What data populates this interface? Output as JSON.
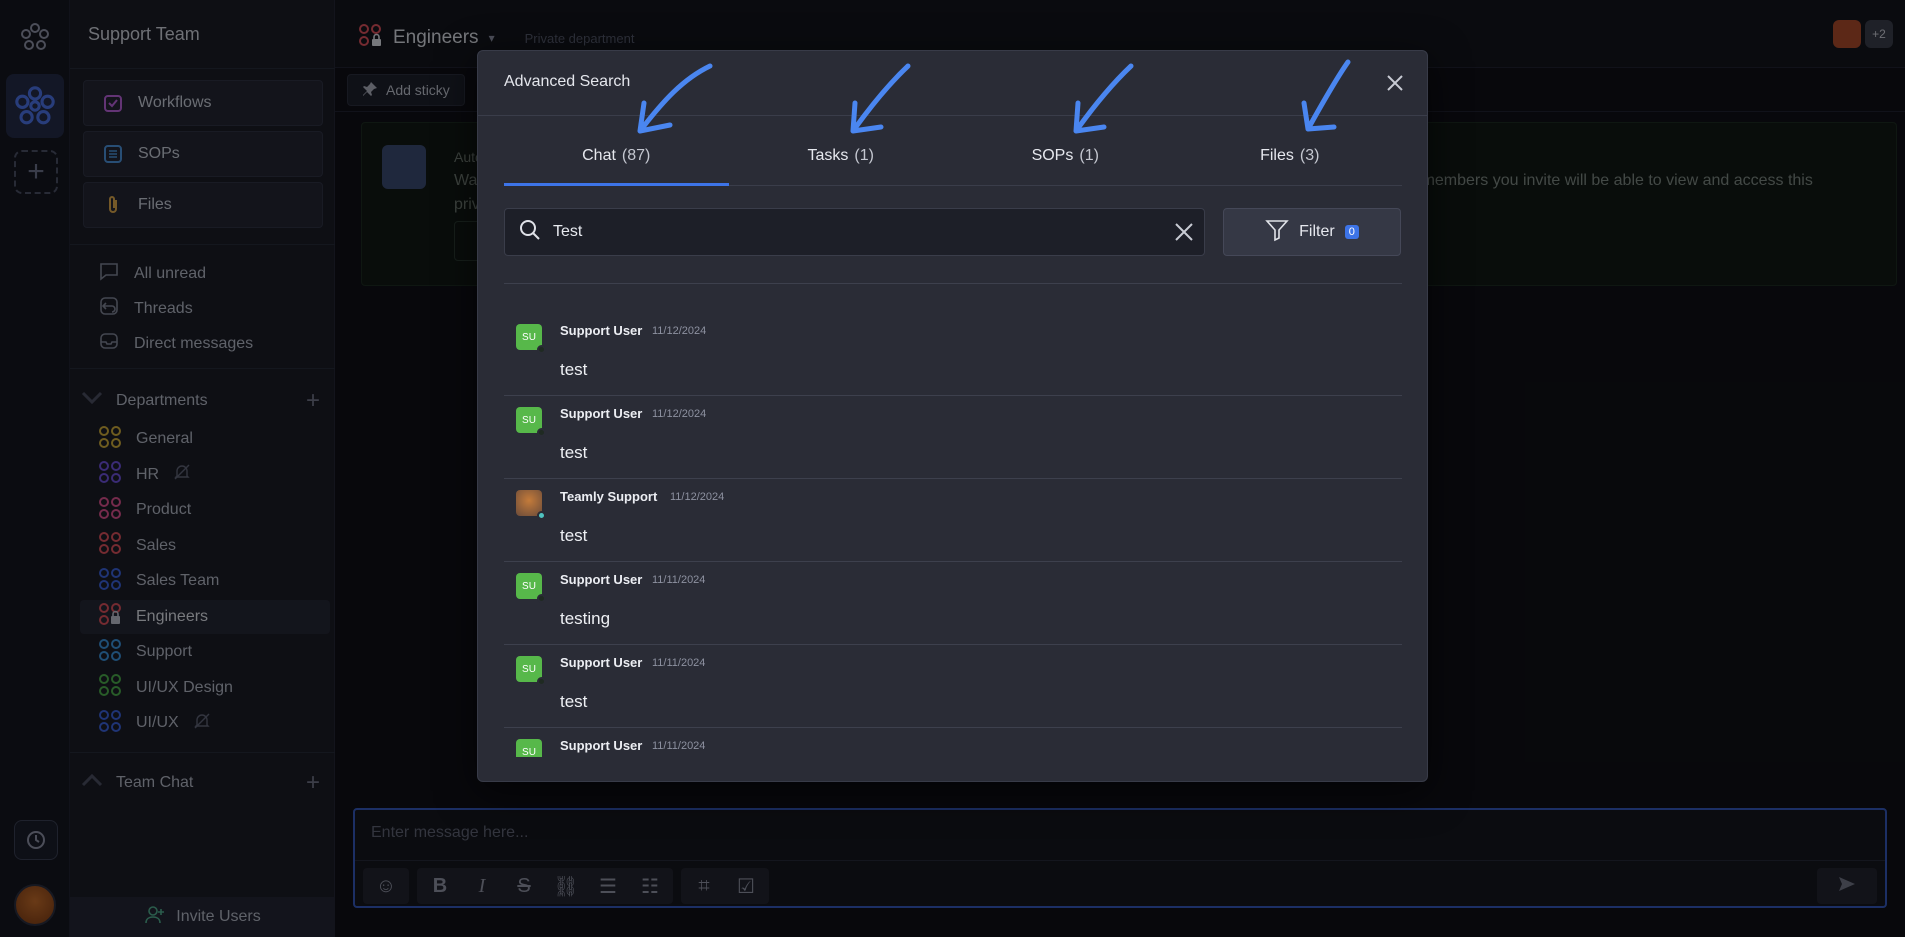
{
  "workspace": {
    "name": "Support Team"
  },
  "sidebar": {
    "nav": [
      {
        "label": "Workflows",
        "icon": "workflow-icon",
        "color": "#b45fd6"
      },
      {
        "label": "SOPs",
        "icon": "sop-icon",
        "color": "#4a8fd6"
      },
      {
        "label": "Files",
        "icon": "paperclip-icon",
        "color": "#d6a24a"
      }
    ],
    "links": [
      {
        "label": "All unread",
        "icon": "chat-bubble-icon"
      },
      {
        "label": "Threads",
        "icon": "threads-icon"
      },
      {
        "label": "Direct messages",
        "icon": "inbox-icon"
      }
    ],
    "departments_label": "Departments",
    "departments": [
      {
        "label": "General",
        "color": "#c9a83a",
        "muted": false,
        "locked": false
      },
      {
        "label": "HR",
        "color": "#6a4fd6",
        "muted": true,
        "locked": false
      },
      {
        "label": "Product",
        "color": "#d64f8a",
        "muted": false,
        "locked": false
      },
      {
        "label": "Sales",
        "color": "#d64f5a",
        "muted": false,
        "locked": false
      },
      {
        "label": "Sales Team",
        "color": "#3a5fd6",
        "muted": false,
        "locked": false
      },
      {
        "label": "Engineers",
        "color": "#d64f5a",
        "muted": false,
        "locked": true
      },
      {
        "label": "Support",
        "color": "#3a8fd6",
        "muted": false,
        "locked": false
      },
      {
        "label": "UI/UX Design",
        "color": "#4aa84a",
        "muted": false,
        "locked": false
      },
      {
        "label": "UI/UX",
        "color": "#3a5fd6",
        "muted": true,
        "locked": false
      }
    ],
    "team_chat_label": "Team Chat",
    "invite_label": "Invite Users"
  },
  "header": {
    "channel": "Engineers",
    "subtitle": "Private department",
    "extra_members": "+2"
  },
  "toolbar": {
    "add_sticky": "Add sticky"
  },
  "banner": {
    "line1": "Auto",
    "line2": "Way",
    "line3": "priv",
    "right_text": "eam members you invite will be able to view and access this"
  },
  "composer": {
    "placeholder": "Enter message here..."
  },
  "modal": {
    "title": "Advanced Search",
    "tabs": [
      {
        "label": "Chat",
        "count": "(87)",
        "active": true
      },
      {
        "label": "Tasks",
        "count": "(1)",
        "active": false
      },
      {
        "label": "SOPs",
        "count": "(1)",
        "active": false
      },
      {
        "label": "Files",
        "count": "(3)",
        "active": false
      }
    ],
    "search_value": "Test",
    "filter_label": "Filter",
    "filter_count": "0",
    "results": [
      {
        "initials": "SU",
        "name": "Support User",
        "date": "11/12/2024",
        "message": "test",
        "avatar": "initials"
      },
      {
        "initials": "SU",
        "name": "Support User",
        "date": "11/12/2024",
        "message": "test",
        "avatar": "initials"
      },
      {
        "initials": "",
        "name": "Teamly Support",
        "date": "11/12/2024",
        "message": "test",
        "avatar": "image"
      },
      {
        "initials": "SU",
        "name": "Support User",
        "date": "11/11/2024",
        "message": "testing",
        "avatar": "initials"
      },
      {
        "initials": "SU",
        "name": "Support User",
        "date": "11/11/2024",
        "message": "test",
        "avatar": "initials"
      },
      {
        "initials": "SU",
        "name": "Support User",
        "date": "11/11/2024",
        "message": "",
        "avatar": "initials"
      }
    ]
  },
  "colors": {
    "accent": "#3d74e8",
    "annotation_arrow": "#4a86f0",
    "avatar_green": "#57b84a"
  }
}
